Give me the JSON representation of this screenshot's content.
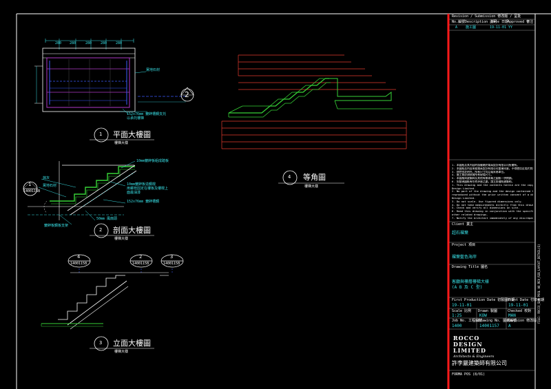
{
  "drawing": {
    "views": [
      {
        "number": "1",
        "title": "平面大樓圖",
        "subtitle": "樓梯大樣"
      },
      {
        "number": "2",
        "title": "剖面大樓圖",
        "subtitle": "樓梯大樣"
      },
      {
        "number": "3",
        "title": "立面大樓圖",
        "subtitle": "樓梯大樣"
      },
      {
        "number": "4",
        "title": "等角圖",
        "subtitle": "樓梯大樣"
      }
    ],
    "plan_dims": [
      "280",
      "280",
      "280",
      "280",
      "280"
    ],
    "plan_annotations": [
      "黨地石材",
      "152x76mm 鍍鋅槽鋼支托",
      "以承托樓梯"
    ],
    "plan_section_marker": "2",
    "section_annotations": [
      "10mm鍍鋅板組成踏板",
      "抹灰",
      "黨地石材",
      "10mm鍍鋅板造鋼樑",
      "用螺栓固定在樓板及樓樑上",
      "面最油漆",
      "152x76mm 鍍鋅槽鋼",
      "50mm 風扇頭",
      "鍍鋅板鋼板支架"
    ],
    "section_ref": {
      "top": "1",
      "bottom": "1400115B"
    },
    "elev_refs": [
      {
        "top": "4",
        "bottom": "1400115B"
      },
      {
        "top": "2",
        "bottom": "1400115B"
      },
      {
        "top": "3",
        "bottom": "1400115B"
      }
    ]
  },
  "title_block": {
    "revision_header": "Revision / Submission 修改版 / 呈批",
    "revision_columns": [
      "No.編號",
      "Description 說明",
      "Date 日期",
      "Approved 審注"
    ],
    "revision_row": [
      "A",
      "施工圖",
      "19-11-01",
      "YY"
    ],
    "notes": [
      "1. 本圖紙及其內容的版權屬於樂高設計有限公司所擁有。",
      "2. 本圖紙及內容未經樂高設計有限公司董事同意，不得使用及用於其他工程項目。",
      "3. 除特別註明外，所有尺寸均以毫米為單位。",
      "4. 施工前必須核實所有現場尺寸。",
      "5. 本圖應與建築師及其他有關專業之圖紙一併閱讀。",
      "6. 如發現圖紙有任何矛盾之處，請立即通知建築師。",
      "1. This drawing and the contents herein are the copyright of Rocco",
      "   Design Limited.",
      "2. No part of the drawing and the design contained herein may be",
      "   reproduced without the prior written consent of a director of Rocco",
      "   Design Limited.",
      "3. Do not scale. Use figured dimensions only.",
      "4. Do not take measurements directly from this drawing.",
      "5. Check and verify all dimensions on site.",
      "6. Read this drawing in conjunction with the specifications and all",
      "   other related drawings.",
      "7. Notify the Architect immediately of any discrepancy found herein."
    ],
    "client_label": "Client 業主",
    "client": "超石裸葉",
    "project_label": "Project 項目",
    "project": "裸葉藍色海岸",
    "drawing_title_label": "Drawing Title 圖名",
    "drawing_title_line1": "客廳與樓層樓梯大樣",
    "drawing_title_line2": "(A  B 及 C 型)",
    "first_production_label": "First Production Date 初製圖日期",
    "first_production": "19-11-01",
    "print_date_label": "Print Date 付印日期",
    "print_date": "19-11-01",
    "scale_label": "Scale 比例",
    "scale": "1:25",
    "drawn_label": "Drawn 製圖",
    "drawn": "KOW",
    "checked_label": "Checked 校對",
    "checked": "MAN",
    "job_label": "Job No. 工程編號",
    "job": "1400",
    "drawing_no_label": "Drawing No. 圖紙編號",
    "drawing_no": "14001157",
    "revision_label": "Revision 修改版",
    "revision": "A",
    "company_line1": "ROCCO",
    "company_line2": "DESIGN",
    "company_line3": "LIMITED",
    "company_sub": "Architects & Engineers",
    "company_chinese": "許李嚴建築師有限公司",
    "form": "FORMA POS (8/01)",
    "side_text": "FILE: ROCCO_SLM POOL A0_REV_R2B_LAYOUT_DETAIL(S)"
  },
  "colors": {
    "frame": "#ffffff",
    "redline": "#ff1a1a",
    "cyan": "#39e0e6",
    "green": "#37d437",
    "magenta": "#b03ac8",
    "blue": "#3b5bff",
    "red": "#e63b2e"
  }
}
